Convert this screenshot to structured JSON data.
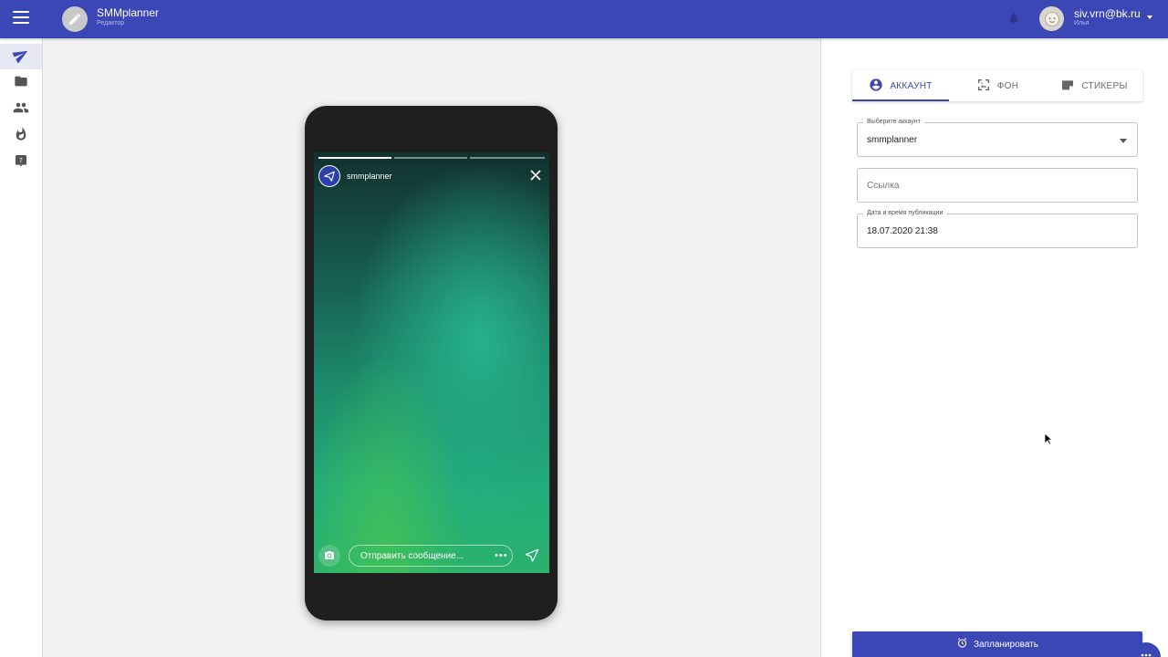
{
  "topbar": {
    "menu_icon": "hamburger-menu-icon",
    "logo_icon": "pencil-icon",
    "title": "SMMplanner",
    "subtitle": "Редактор",
    "bell_icon": "bell-icon",
    "user_email": "siv.vrn@bk.ru",
    "user_name": "Илья",
    "brand_color": "#3a47b5"
  },
  "sidebar": {
    "items": [
      {
        "icon": "send-icon",
        "active": true
      },
      {
        "icon": "folder-icon",
        "active": false
      },
      {
        "icon": "people-icon",
        "active": false
      },
      {
        "icon": "fire-icon",
        "active": false
      },
      {
        "icon": "help-icon",
        "active": false
      }
    ]
  },
  "story": {
    "account_name": "smmplanner",
    "message_placeholder": "Отправить сообщение...",
    "segments": 3,
    "segments_viewed": 1
  },
  "panel": {
    "tabs": [
      {
        "label": "АККАУНТ",
        "icon": "account-circle-icon",
        "active": true
      },
      {
        "label": "ФОН",
        "icon": "image-frame-icon",
        "active": false
      },
      {
        "label": "СТИКЕРЫ",
        "icon": "sticker-icon",
        "active": false
      }
    ],
    "account_select": {
      "label": "Выберите аккаунт",
      "value": "smmplanner"
    },
    "link_field": {
      "placeholder": "Ссылка"
    },
    "datetime_field": {
      "label": "Дата и время публикации",
      "value": "18.07.2020 21:38"
    },
    "schedule_button": "Запланировать",
    "accent_color": "#3a47b5"
  }
}
